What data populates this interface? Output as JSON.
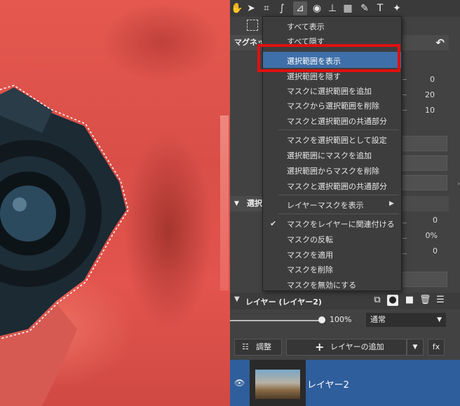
{
  "toolbar": {
    "tools": [
      "hand-tool",
      "select-tool",
      "crop-tool",
      "retouch-tool",
      "lasso-tool",
      "view-tool",
      "levels-tool",
      "grid-tool",
      "brush-tool",
      "text-tool",
      "magic-tool"
    ]
  },
  "section_magnet": {
    "label": "マグネッ"
  },
  "section_select": {
    "label": "選択"
  },
  "values_top": [
    "0",
    "20",
    "10"
  ],
  "values_bottom": [
    "0",
    "0%",
    "0"
  ],
  "menu": {
    "items": [
      {
        "label": "すべて表示"
      },
      {
        "label": "すべて隠す"
      },
      {
        "label": "選択範囲を表示"
      },
      {
        "label": "選択範囲を隠す"
      },
      {
        "label": "マスクに選択範囲を追加"
      },
      {
        "label": "マスクから選択範囲を削除"
      },
      {
        "label": "マスクと選択範囲の共通部分"
      },
      {
        "label": "マスクを選択範囲として設定"
      },
      {
        "label": "選択範囲にマスクを追加"
      },
      {
        "label": "選択範囲からマスクを削除"
      },
      {
        "label": "マスクと選択範囲の共通部分"
      },
      {
        "label": "レイヤーマスクを表示"
      },
      {
        "label": "マスクをレイヤーに関連付ける"
      },
      {
        "label": "マスクの反転"
      },
      {
        "label": "マスクを適用"
      },
      {
        "label": "マスクを削除"
      },
      {
        "label": "マスクを無効にする"
      }
    ],
    "highlight_color": "#3f6fa8",
    "annotation_color": "#e01010"
  },
  "layers": {
    "header": "レイヤー (レイヤー2)",
    "opacity": "100%",
    "blend_mode": "通常",
    "adjust_label": "調整",
    "add_layer_label": "レイヤーの追加",
    "fx_label": "fx",
    "layer_name": "レイヤー2",
    "selected_color": "#2f5e9c"
  }
}
